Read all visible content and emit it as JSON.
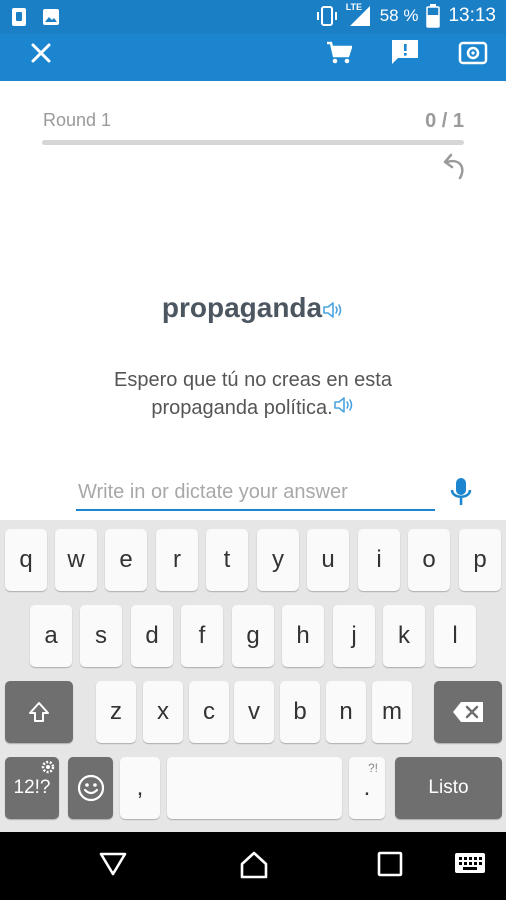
{
  "status_bar": {
    "network": "LTE",
    "battery": "58 %",
    "time": "13:13",
    "icons": [
      "sim-card-icon",
      "image-icon",
      "vibrate-icon",
      "signal-icon",
      "battery-icon"
    ]
  },
  "toolbar": {
    "icons": [
      "close-icon",
      "cart-icon",
      "feedback-icon",
      "settings-icon"
    ]
  },
  "progress": {
    "round_label": "Round 1",
    "count": "0 / 1",
    "fraction": 0
  },
  "card": {
    "word": "propaganda",
    "sentence": "Espero que tú no creas en esta propaganda política."
  },
  "answer": {
    "placeholder": "Write in or dictate your answer",
    "value": ""
  },
  "keyboard": {
    "row1": [
      "q",
      "w",
      "e",
      "r",
      "t",
      "y",
      "u",
      "i",
      "o",
      "p"
    ],
    "row2": [
      "a",
      "s",
      "d",
      "f",
      "g",
      "h",
      "j",
      "k",
      "l"
    ],
    "row3": [
      "z",
      "x",
      "c",
      "v",
      "b",
      "n",
      "m"
    ],
    "symbols_label": "12!?",
    "comma_label": ",",
    "period_label": ".",
    "period_alt": "?!",
    "done_label": "Listo"
  },
  "colors": {
    "primary": "#1b86cf",
    "status_bar": "#1b7fc6",
    "keyboard_bg": "#e6e6e6",
    "key_dark": "#6f6f6f"
  }
}
